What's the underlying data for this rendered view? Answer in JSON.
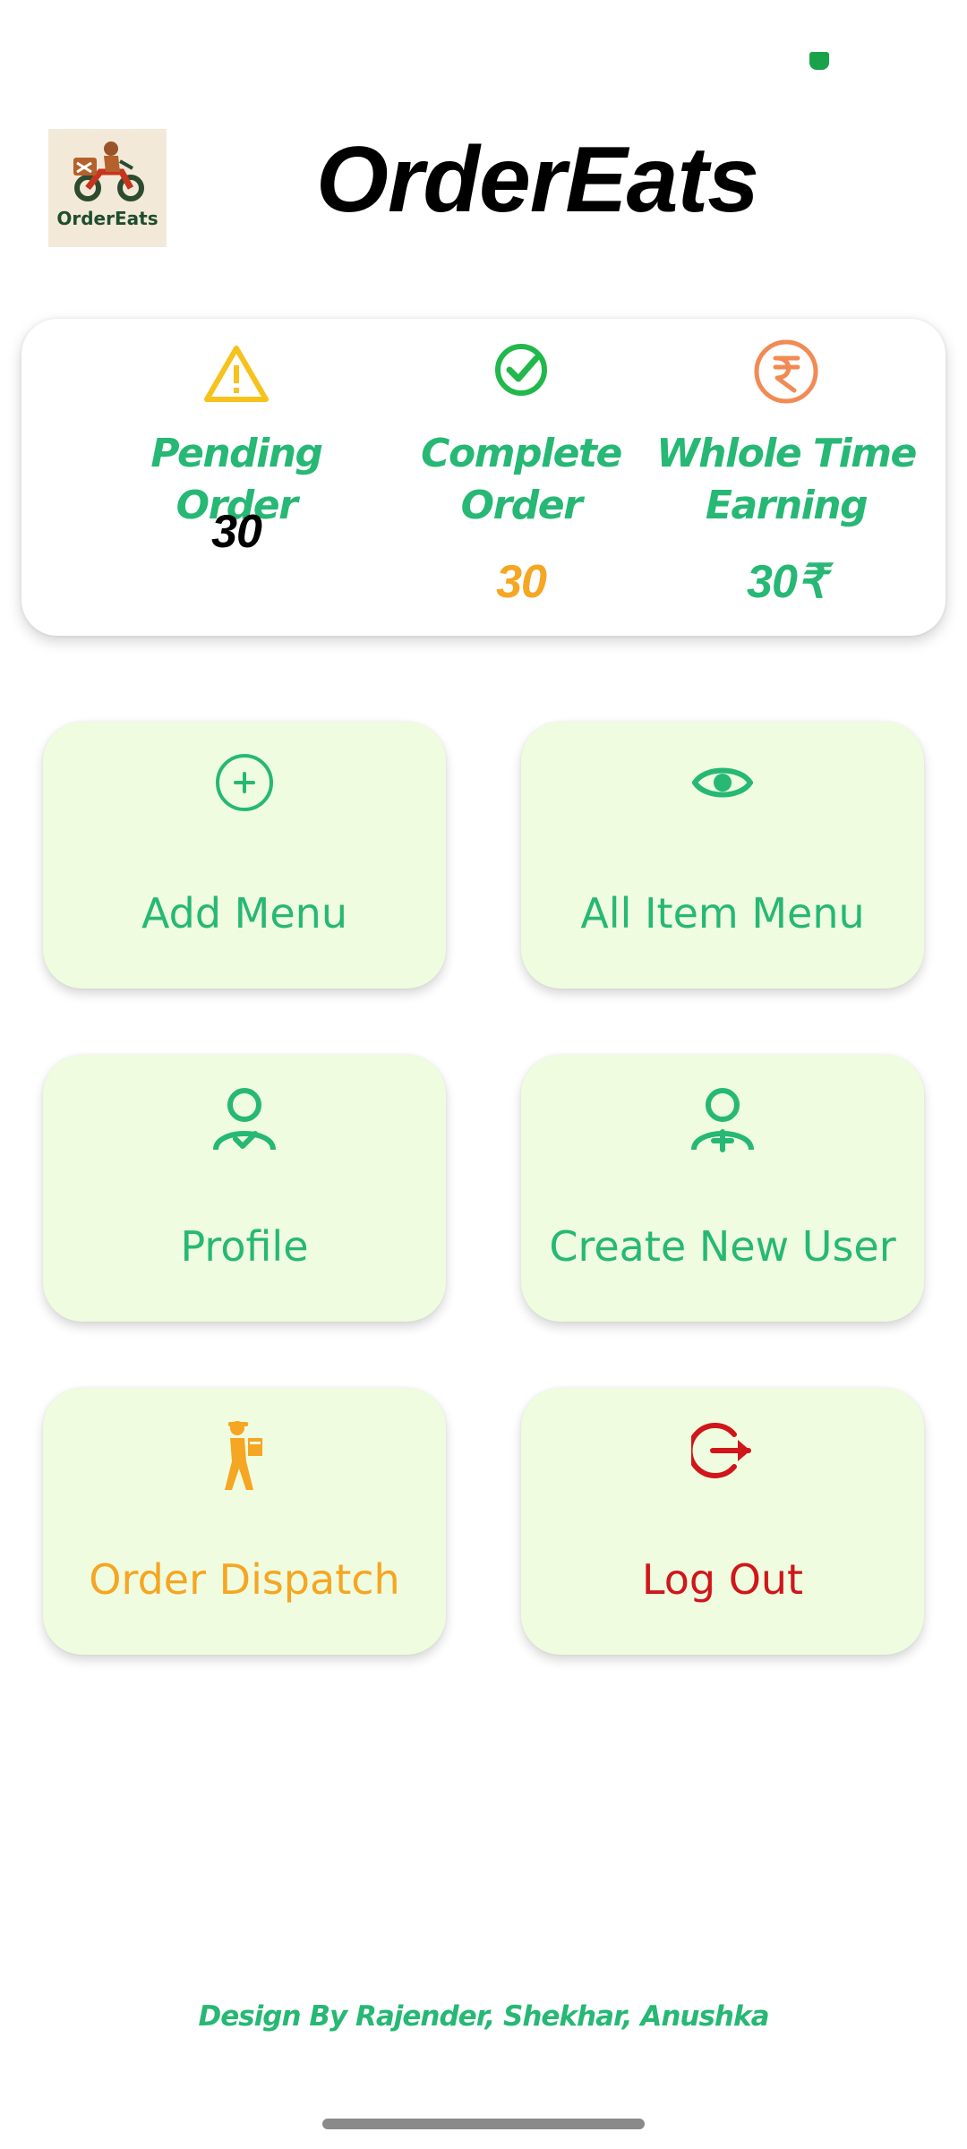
{
  "app": {
    "title": "OrderEats",
    "logo_text": "OrderEats"
  },
  "stats": {
    "pending": {
      "label": "Pending Order",
      "value": "30",
      "icon": "warning-icon",
      "color": "#f6c21b"
    },
    "complete": {
      "label_line1": "Complete",
      "label_line2": "Order",
      "value": "30",
      "icon": "check-circle-icon",
      "color": "#f5a623"
    },
    "earning": {
      "label_line1": "Whlole Time",
      "label_line2": "Earning",
      "value": "30₹",
      "icon": "rupee-icon",
      "color": "#f28a54"
    }
  },
  "menu": {
    "add_menu": {
      "label": "Add Menu",
      "icon": "plus-circle-icon"
    },
    "all_item_menu": {
      "label": "All Item Menu",
      "icon": "eye-icon"
    },
    "profile": {
      "label": "Profile",
      "icon": "user-check-icon"
    },
    "create_user": {
      "label": "Create New User",
      "icon": "user-plus-icon"
    },
    "order_dispatch": {
      "label": "Order Dispatch",
      "icon": "delivery-person-icon"
    },
    "log_out": {
      "label": "Log Out",
      "icon": "logout-icon"
    }
  },
  "colors": {
    "accent_green": "#26b874",
    "tile_bg": "#effcdf",
    "orange": "#f5a623",
    "red": "#d0161b"
  },
  "footer": {
    "credit": "Design By Rajender, Shekhar, Anushka"
  }
}
